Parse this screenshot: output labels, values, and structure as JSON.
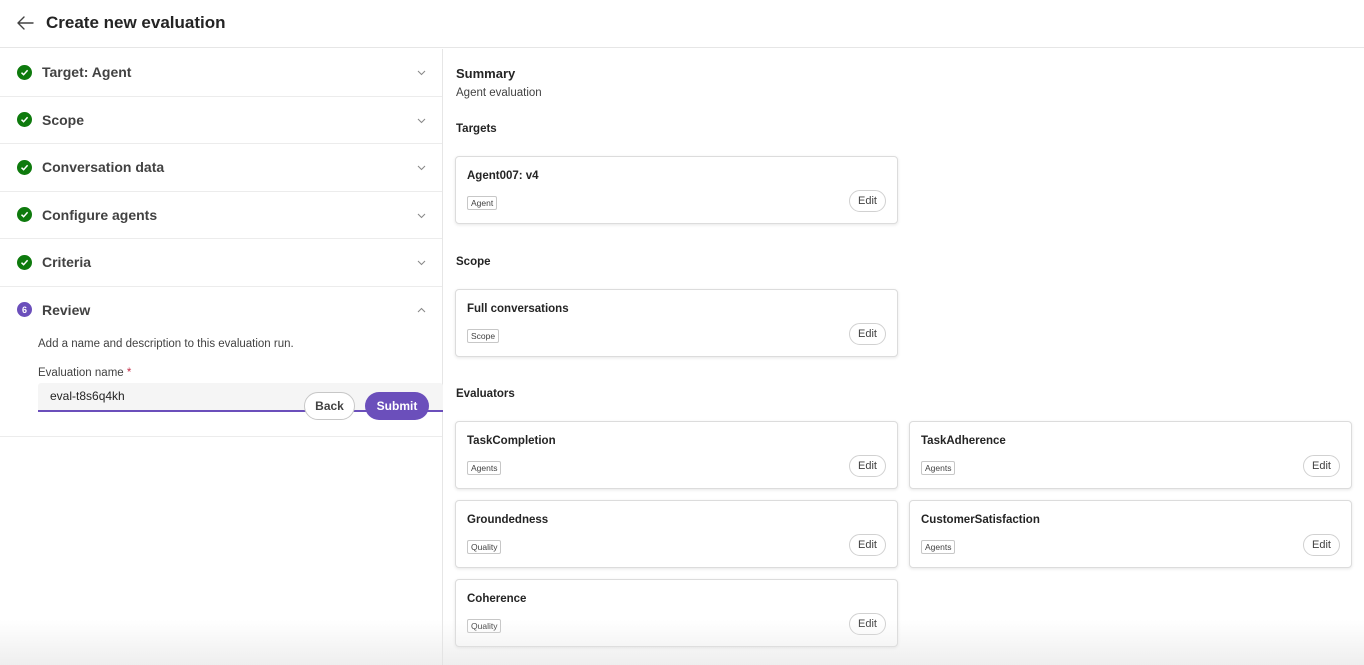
{
  "header": {
    "title": "Create new evaluation",
    "back_icon": "arrow-left-icon"
  },
  "steps": [
    {
      "label": "Target: Agent",
      "status": "complete"
    },
    {
      "label": "Scope",
      "status": "complete"
    },
    {
      "label": "Conversation data",
      "status": "complete"
    },
    {
      "label": "Configure agents",
      "status": "complete"
    },
    {
      "label": "Criteria",
      "status": "complete"
    }
  ],
  "review": {
    "number": "6",
    "label": "Review",
    "description": "Add a name and description to this evaluation run.",
    "name_label": "Evaluation name",
    "required_mark": "*",
    "name_value": "eval-t8s6q4kh",
    "back_label": "Back",
    "submit_label": "Submit"
  },
  "summary": {
    "title": "Summary",
    "subtitle": "Agent evaluation",
    "targets_title": "Targets",
    "scope_title": "Scope",
    "evaluators_title": "Evaluators",
    "edit_label": "Edit",
    "targets": [
      {
        "title": "Agent007: v4",
        "tag": "Agent"
      }
    ],
    "scope": [
      {
        "title": "Full conversations",
        "tag": "Scope"
      }
    ],
    "evaluators": [
      {
        "title": "TaskCompletion",
        "tag": "Agents"
      },
      {
        "title": "TaskAdherence",
        "tag": "Agents"
      },
      {
        "title": "Groundedness",
        "tag": "Quality"
      },
      {
        "title": "CustomerSatisfaction",
        "tag": "Agents"
      },
      {
        "title": "Coherence",
        "tag": "Quality"
      }
    ]
  },
  "colors": {
    "accent": "#6b4fbb",
    "success": "#0e7a0d"
  }
}
